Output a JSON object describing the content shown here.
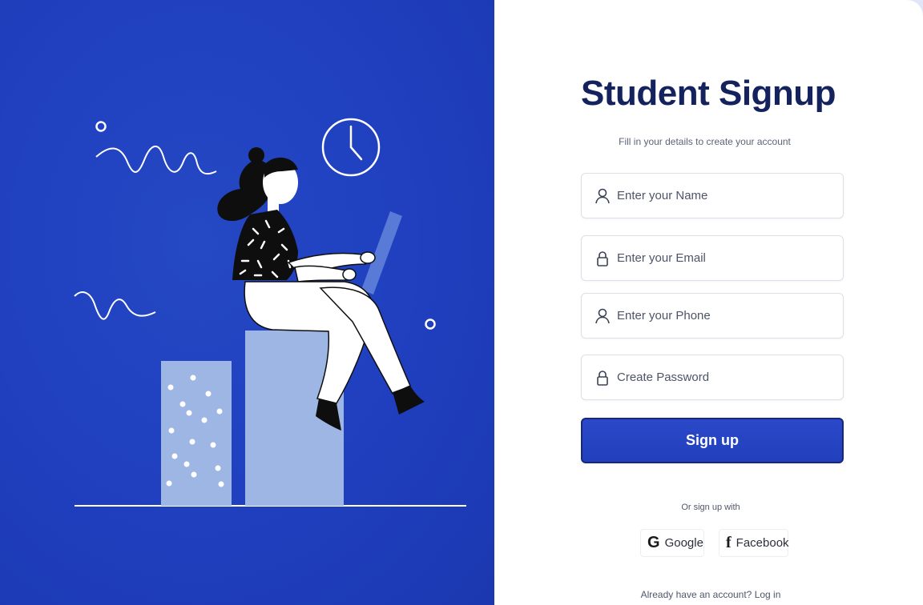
{
  "signup": {
    "title": "Student Signup",
    "subtitle": "Fill in your details to create your account",
    "fields": [
      {
        "placeholder": "Enter your Name",
        "icon": "user-icon"
      },
      {
        "placeholder": "Enter your Email",
        "icon": "lock-icon"
      },
      {
        "placeholder": "Enter your Phone",
        "icon": "user-icon"
      },
      {
        "placeholder": "Create Password",
        "icon": "lock-icon"
      }
    ],
    "submit_label": "Sign up",
    "or_text": "Or sign up with",
    "social": [
      {
        "label": "Google",
        "icon": "google-icon",
        "glyph": "G"
      },
      {
        "label": "Facebook",
        "icon": "facebook-icon",
        "glyph": "f"
      }
    ],
    "footer": "Already have an account? Log in"
  },
  "colors": {
    "panel_blue": "#1f3fbf",
    "title_navy": "#14235e",
    "button_blue": "#2140bd"
  }
}
